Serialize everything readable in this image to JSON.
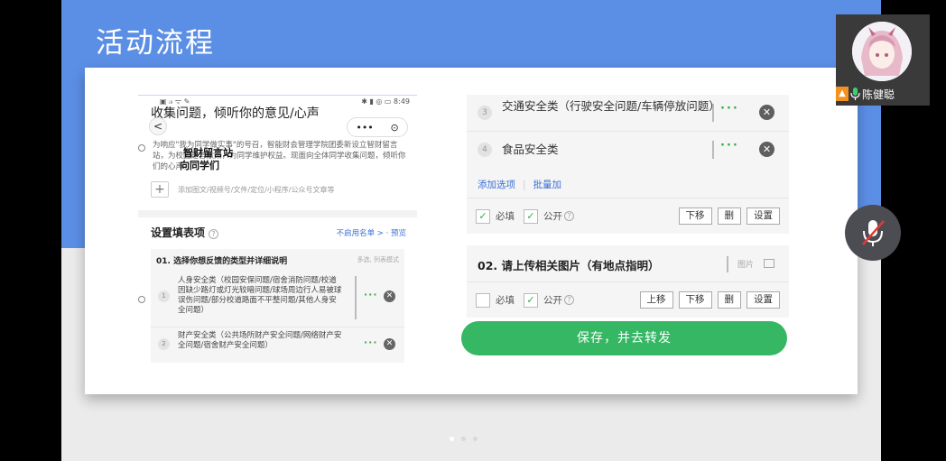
{
  "slide": {
    "title": "活动流程",
    "accent_color": "#5b8fe6",
    "page_dots": 3,
    "active_dot": 1
  },
  "phone": {
    "status_left": "▣ ᵢₗₗ ᯤ ✎",
    "status_right": "✱ ▮ ◎ ▭ 8:49",
    "title": "收集问题，倾听你的意见/心声",
    "back": "<",
    "capsule_more": "•••",
    "capsule_close": "⊙",
    "description": "为响应\"我为同学做实事\"的号召，智能财会管理学院团委新设立智财留言站，为校园建言献策，为同学维护权益。现面向全体同学收集问题，倾听你们的心声。",
    "overlay_line1": "智财留言站",
    "overlay_line2": "向同学们",
    "add_placeholder": "添加图文/视频号/文件/定位/小程序/公众号文章等",
    "settings_title": "设置填表项",
    "settings_links": "不启用名单 >  ·  预览",
    "question1_title": "01. 选择你想反馈的类型并详细说明",
    "question1_mode": "多选, 列表模式",
    "options": [
      {
        "num": "1",
        "text": "人身安全类（校园安保问题/宿舍消防问题/校道因缺少路灯或灯光较暗问题/球场周边行人易被球误伤问题/部分校道路面不平整问题/其他人身安全问题）"
      },
      {
        "num": "2",
        "text": "财产安全类（公共场所财产安全问题/网络财产安全问题/宿舍财产安全问题）"
      }
    ],
    "more": "···",
    "delete": "✕"
  },
  "right_panel": {
    "options": [
      {
        "num": "3",
        "text": "交通安全类（行驶安全问题/车辆停放问题）"
      },
      {
        "num": "4",
        "text": "食品安全类"
      }
    ],
    "more": "···",
    "delete": "✕",
    "add_option": "添加选项",
    "batch_add": "批量加",
    "q1_controls": {
      "required": "必填",
      "required_checked": true,
      "public": "公开",
      "public_checked": true,
      "help": "?",
      "buttons": [
        "下移",
        "删",
        "设置"
      ]
    },
    "question2_title": "02. 请上传相关图片（有地点指明）",
    "question2_mode": "图片",
    "q2_controls": {
      "required": "必填",
      "required_checked": false,
      "public": "公开",
      "public_checked": true,
      "help": "?",
      "buttons": [
        "上移",
        "下移",
        "删",
        "设置"
      ]
    },
    "save_button": "保存，并去转发"
  },
  "participant": {
    "name": "陈健聪",
    "host_icon": "host-badge-icon",
    "mic_icon": "microphone-icon"
  },
  "toolbar": {
    "mute_icon": "microphone-muted-icon"
  }
}
